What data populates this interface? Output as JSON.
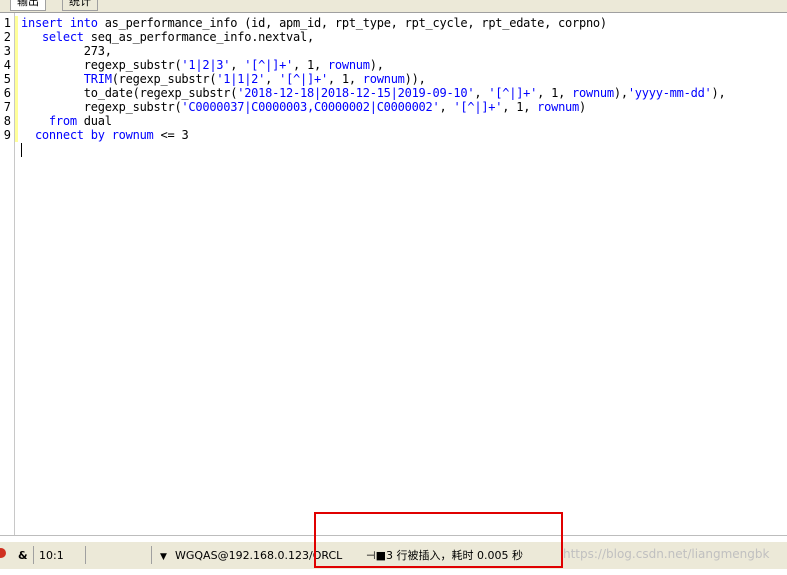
{
  "tabs": [
    {
      "label": "输出"
    },
    {
      "label": "统计"
    }
  ],
  "editor": {
    "line_numbers": [
      "1",
      "2",
      "3",
      "4",
      "5",
      "6",
      "7",
      "8",
      "9"
    ],
    "code": {
      "l1": {
        "a": "insert into",
        "b": " as_performance_info (id, apm_id, rpt_type, rpt_cycle, rpt_edate, corpno)"
      },
      "l2": {
        "pre": "   ",
        "kw": "select",
        "b": " seq_as_performance_info.nextval,"
      },
      "l3": {
        "b": "         273,"
      },
      "l4": {
        "a": "         regexp_substr(",
        "s1": "'1|2|3'",
        "c1": ", ",
        "s2": "'[^|]+'",
        "c2": ", 1, ",
        "k": "rownum",
        "e": "),"
      },
      "l5": {
        "pre": "         ",
        "fn": "TRIM",
        "a": "(regexp_substr(",
        "s1": "'1|1|2'",
        "c1": ", ",
        "s2": "'[^|]+'",
        "c2": ", 1, ",
        "k": "rownum",
        "e": ")),"
      },
      "l6": {
        "a": "         to_date(regexp_substr(",
        "s1": "'2018-12-18|2018-12-15|2019-09-10'",
        "c1": ", ",
        "s2": "'[^|]+'",
        "c2": ", 1, ",
        "k": "rownum",
        "e": "),",
        "s3": "'yyyy-mm-dd'",
        "f": "),"
      },
      "l7": {
        "a": "         regexp_substr(",
        "s1": "'C0000037|C0000003,C0000002|C0000002'",
        "c1": ", ",
        "s2": "'[^|]+'",
        "c2": ", 1, ",
        "k": "rownum",
        "e": ")"
      },
      "l8": {
        "pre": "    ",
        "kw": "from",
        "b": " dual"
      },
      "l9": {
        "pre": "  ",
        "kw1": "connect by",
        "sp": " ",
        "k": "rownum",
        "b": " <= 3"
      }
    }
  },
  "status": {
    "ampersand": "&",
    "cursor": "10:1",
    "connection": "WGQAS@192.168.0.123/ORCL",
    "message": "3 行被插入，耗时 0.005 秒",
    "watermark": "https://blog.csdn.net/liangmengbk"
  },
  "colors": {
    "keyword": "#0000ff",
    "highlight_box": "#e00000"
  }
}
